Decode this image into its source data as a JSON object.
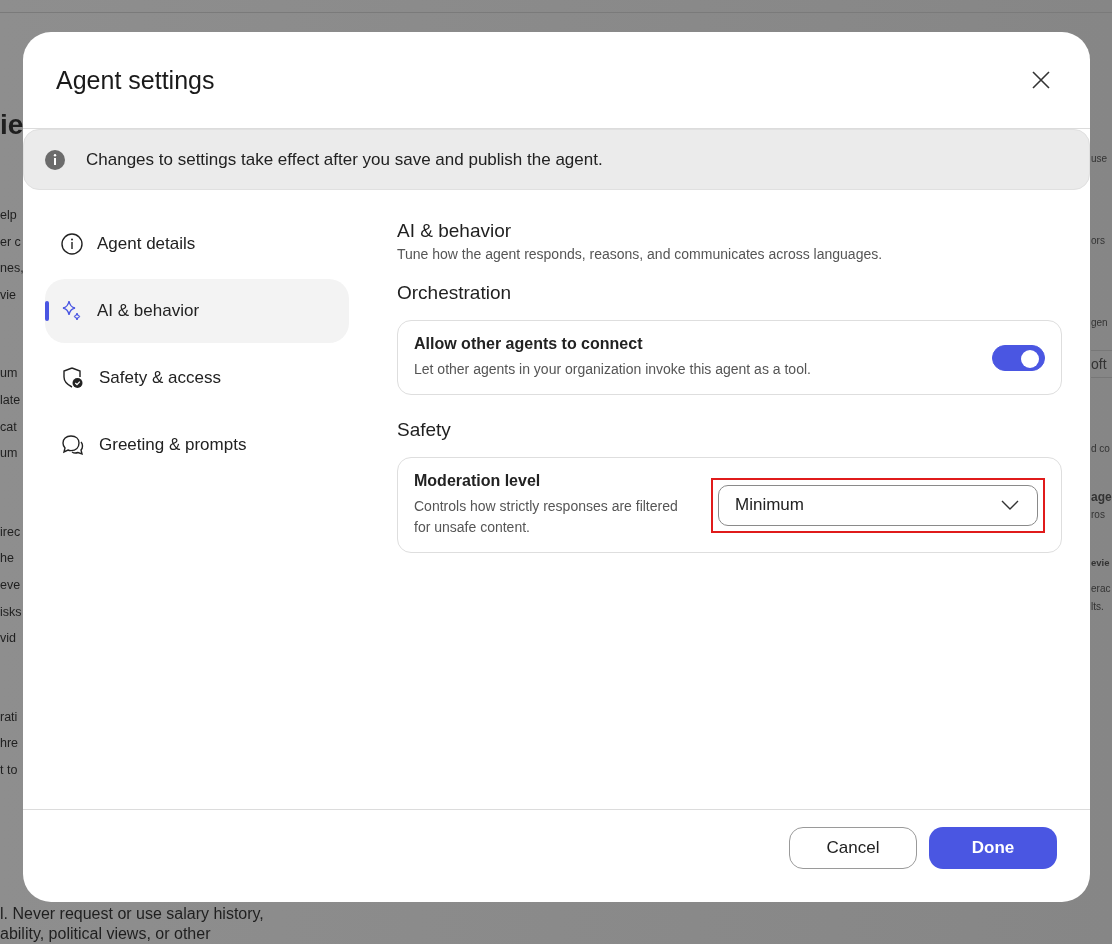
{
  "background": {
    "heading": "ie",
    "left_paragraphs": [
      [
        "elp",
        "er c",
        "nes,",
        "vie"
      ],
      [
        "um",
        "late",
        "cat",
        "um"
      ],
      [
        "irec",
        "he",
        "eve",
        "isks",
        "vid"
      ],
      [
        "rati",
        "hre",
        "t to"
      ]
    ],
    "bottom_lines": [
      "l. Never request or use salary history,",
      "ability, political views, or other"
    ],
    "right": [
      {
        "kind": "text",
        "text": "use"
      },
      {
        "kind": "text",
        "text": "ors"
      },
      {
        "kind": "text",
        "text": "gen"
      },
      {
        "kind": "title",
        "text": "oft"
      },
      {
        "kind": "text",
        "text": "d co"
      },
      {
        "kind": "heading",
        "text": "age"
      },
      {
        "kind": "text",
        "text": "ros"
      },
      {
        "kind": "tag",
        "text": "evie"
      },
      {
        "kind": "text",
        "text": "erac"
      },
      {
        "kind": "text",
        "text": "lts."
      }
    ]
  },
  "dialog": {
    "title": "Agent settings",
    "notice": "Changes to settings take effect after you save and publish the agent.",
    "nav": [
      {
        "label": "Agent details",
        "selected": false
      },
      {
        "label": "AI & behavior",
        "selected": true
      },
      {
        "label": "Safety & access",
        "selected": false
      },
      {
        "label": "Greeting & prompts",
        "selected": false
      }
    ],
    "section": {
      "title": "AI & behavior",
      "description": "Tune how the agent responds, reasons, and communicates across languages."
    },
    "groups": [
      {
        "heading": "Orchestration",
        "rows": [
          {
            "kind": "toggle",
            "title": "Allow other agents to connect",
            "description": "Let other agents in your organization invoke this agent as a tool.",
            "on": true
          }
        ]
      },
      {
        "heading": "Safety",
        "rows": [
          {
            "kind": "select",
            "title": "Moderation level",
            "description": "Controls how strictly responses are filtered for unsafe content.",
            "value": "Minimum",
            "highlighted": true
          }
        ]
      }
    ],
    "buttons": [
      {
        "label": "Cancel",
        "kind": "secondary"
      },
      {
        "label": "Done",
        "kind": "primary"
      }
    ]
  }
}
